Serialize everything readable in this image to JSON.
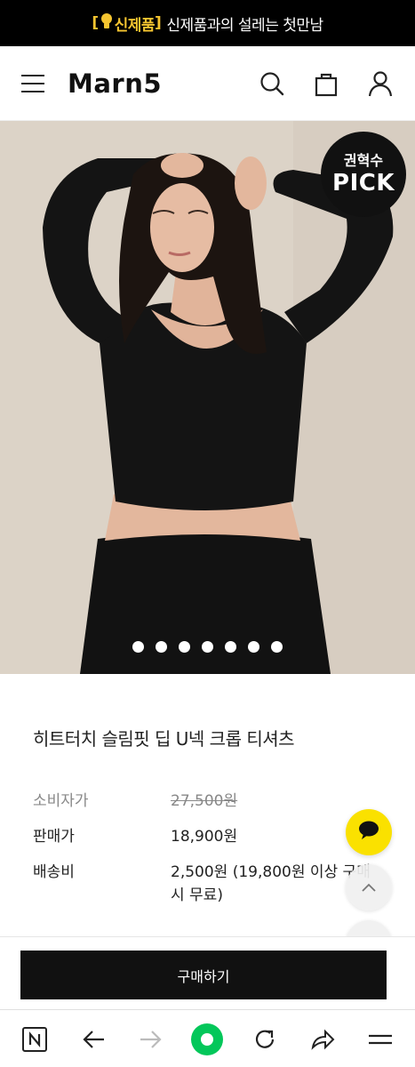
{
  "promo": {
    "bracket_open": "[",
    "bulb_icon": "lightbulb-icon",
    "tag": "신제품",
    "bracket_close": "]",
    "message": "신제품과의 설레는 첫만남"
  },
  "header": {
    "logo": "Marn5",
    "icons": [
      "menu-icon",
      "search-icon",
      "shopping-bag-icon",
      "user-icon"
    ]
  },
  "hero": {
    "badge_line1": "권혁수",
    "badge_line2": "PICK",
    "slide_count": 7
  },
  "product": {
    "title": "히트터치 슬림핏 딥 U넥 크롭 티셔츠",
    "consumer_price_label": "소비자가",
    "consumer_price": "27,500원",
    "sale_price_label": "판매가",
    "sale_price": "18,900원",
    "shipping_label": "배송비",
    "shipping_value": "2,500원 (19,800원 이상 구매 시 무료)"
  },
  "floating": {
    "chat_icon": "chat-bubble-icon",
    "up_icon": "chevron-up-icon",
    "down_icon": "chevron-down-icon"
  },
  "buy": {
    "label": "구매하기"
  },
  "browser_nav": {
    "icons": [
      "naver-home-icon",
      "back-arrow-icon",
      "forward-arrow-icon",
      "green-home-icon",
      "refresh-icon",
      "share-icon",
      "menu-icon"
    ]
  },
  "colors": {
    "accent_yellow": "#f4c430",
    "kakao_yellow": "#fae100",
    "green": "#03c75a",
    "black": "#111111"
  }
}
